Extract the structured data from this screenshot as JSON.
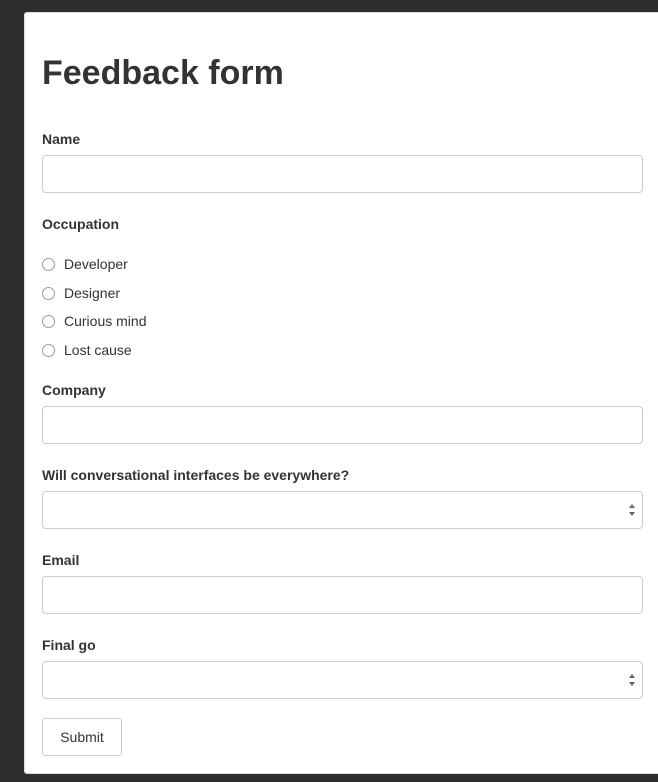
{
  "form": {
    "title": "Feedback form",
    "name": {
      "label": "Name",
      "value": "",
      "placeholder": ""
    },
    "occupation": {
      "label": "Occupation",
      "options": [
        "Developer",
        "Designer",
        "Curious mind",
        "Lost cause"
      ],
      "selected": null
    },
    "company": {
      "label": "Company",
      "value": "",
      "placeholder": ""
    },
    "conversational": {
      "label": "Will conversational interfaces be everywhere?",
      "selected_value": ""
    },
    "email": {
      "label": "Email",
      "value": "",
      "placeholder": ""
    },
    "final_go": {
      "label": "Final go",
      "selected_value": ""
    },
    "submit_label": "Submit"
  },
  "icons": {
    "radio": "radio-unchecked-icon",
    "select_arrows": "up-down-arrows-icon"
  },
  "colors": {
    "background": "#2d2d30",
    "panel": "#ffffff",
    "text": "#333333",
    "border": "#cccccc"
  }
}
